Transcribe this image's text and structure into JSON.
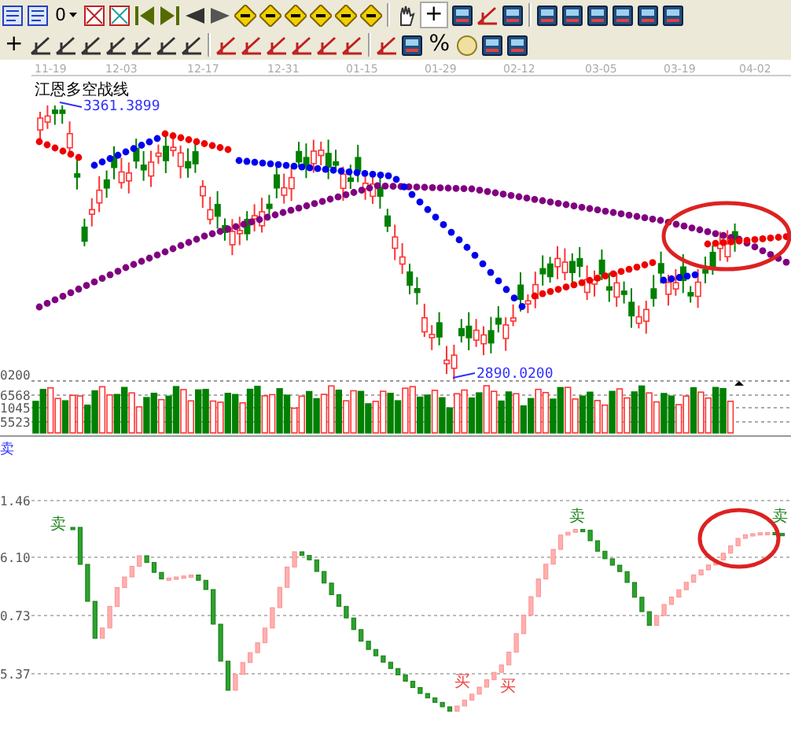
{
  "toolbar": {
    "zoom_value": "0",
    "crosshair_glyph": "+",
    "plus_glyph": "+",
    "percent_glyph": "%"
  },
  "price_chart": {
    "title": "江恩多空战线",
    "dates": [
      "11-19",
      "12-03",
      "12-17",
      "12-31",
      "01-15",
      "01-29",
      "02-12",
      "03-05",
      "03-19",
      "04-02"
    ],
    "high_label": "3361.3899",
    "low_label": "2890.0200",
    "axis_label": "0200"
  },
  "volume_chart": {
    "axis_labels": [
      "6568",
      "1045",
      "5523"
    ]
  },
  "indicator": {
    "label": "卖",
    "axis_labels": [
      "1.46",
      "6.10",
      "0.73",
      "5.37"
    ],
    "signals": [
      {
        "text": "卖",
        "kind": "sell"
      },
      {
        "text": "买",
        "kind": "buy"
      },
      {
        "text": "买",
        "kind": "buy"
      },
      {
        "text": "卖",
        "kind": "sell"
      },
      {
        "text": "卖",
        "kind": "sell"
      }
    ]
  }
}
